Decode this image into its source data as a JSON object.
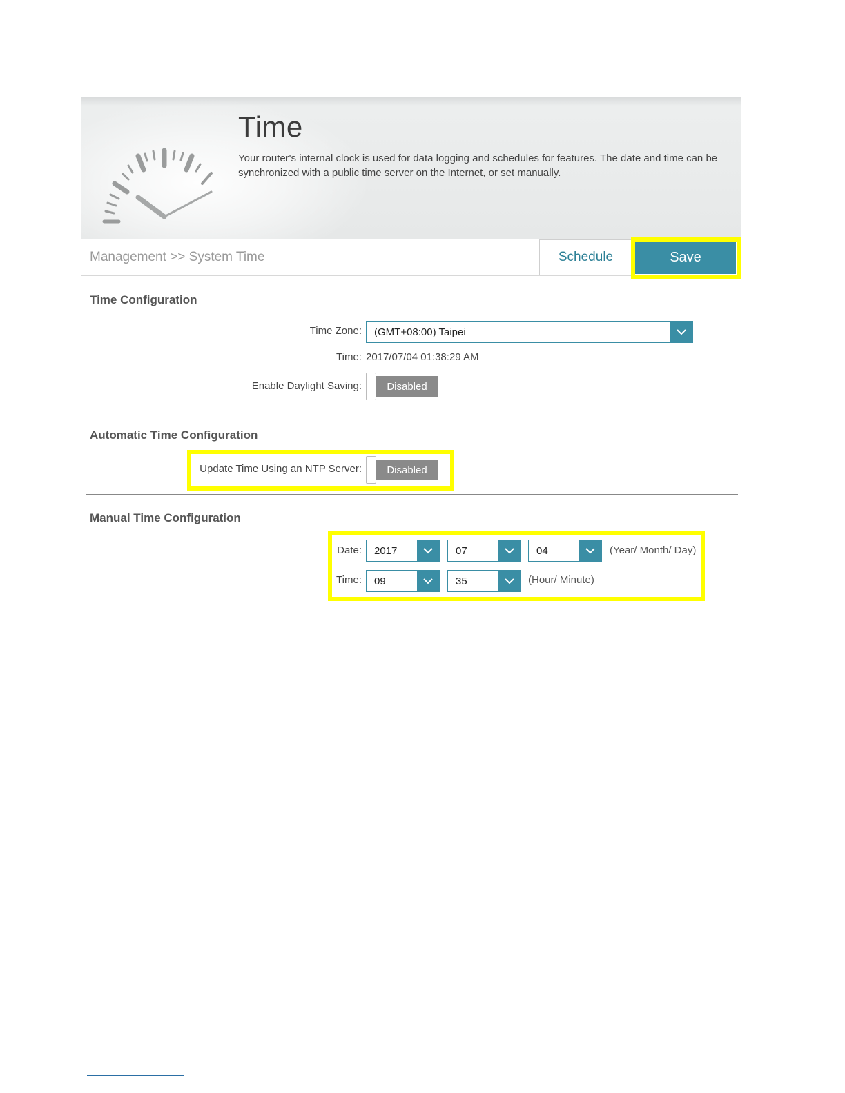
{
  "header": {
    "title": "Time",
    "description": "Your router's internal clock is used for data logging and schedules for features. The date and time can be synchronized with a public time server on the Internet, or set manually."
  },
  "breadcrumb": "Management >> System Time",
  "actions": {
    "schedule_label": "Schedule",
    "save_label": "Save"
  },
  "time_config": {
    "heading": "Time Configuration",
    "timezone_label": "Time Zone:",
    "timezone_value": "(GMT+08:00) Taipei",
    "time_label": "Time:",
    "time_value": "2017/07/04 01:38:29 AM",
    "dst_label": "Enable Daylight Saving:",
    "dst_state": "Disabled"
  },
  "auto_config": {
    "heading": "Automatic Time Configuration",
    "ntp_label": "Update Time Using an NTP Server:",
    "ntp_state": "Disabled"
  },
  "manual_config": {
    "heading": "Manual Time Configuration",
    "date_label": "Date:",
    "year": "2017",
    "month": "07",
    "day": "04",
    "date_hint": "(Year/ Month/ Day)",
    "time_label": "Time:",
    "hour": "09",
    "minute": "35",
    "time_hint": "(Hour/ Minute)"
  },
  "colors": {
    "accent": "#3a8ea5",
    "highlight": "#ffff00",
    "toggle_off": "#8a8a8a"
  }
}
